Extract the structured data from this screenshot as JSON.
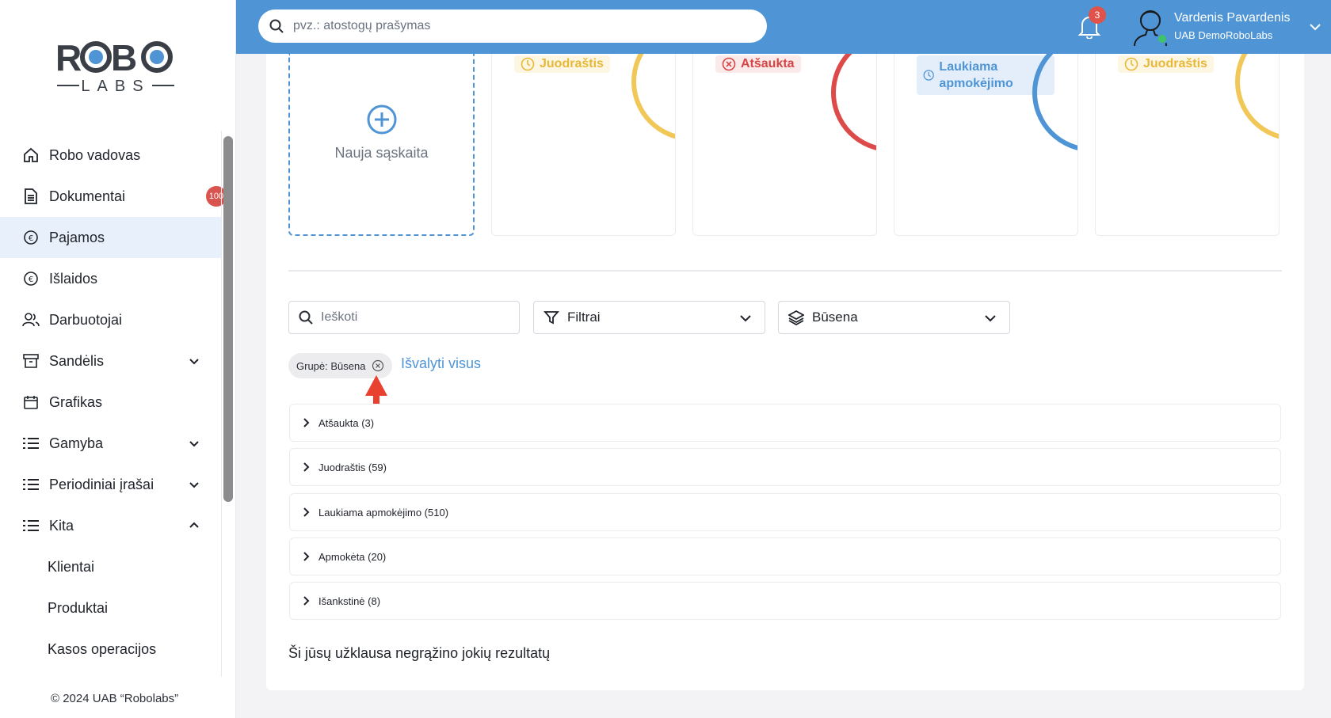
{
  "brand": {
    "logo_top": "ROBO",
    "logo_bottom": "LABS"
  },
  "sidebar": {
    "items": [
      {
        "label": "Robo vadovas",
        "icon": "home-icon"
      },
      {
        "label": "Dokumentai",
        "icon": "document-icon",
        "badge": "100"
      },
      {
        "label": "Pajamos",
        "icon": "income-icon",
        "active": true
      },
      {
        "label": "Išlaidos",
        "icon": "expense-icon"
      },
      {
        "label": "Darbuotojai",
        "icon": "users-icon"
      },
      {
        "label": "Sandėlis",
        "icon": "archive-icon",
        "expandable": true
      },
      {
        "label": "Grafikas",
        "icon": "calendar-icon"
      },
      {
        "label": "Gamyba",
        "icon": "list-icon",
        "expandable": true
      },
      {
        "label": "Periodiniai įrašai",
        "icon": "list-icon",
        "expandable": true
      },
      {
        "label": "Kita",
        "icon": "list-icon",
        "expandable": true,
        "expanded": true
      },
      {
        "label": "Klientai",
        "sub": true
      },
      {
        "label": "Produktai",
        "sub": true
      },
      {
        "label": "Kasos operacijos",
        "sub": true
      }
    ],
    "copyright": "© 2024 UAB “Robolabs”"
  },
  "topbar": {
    "search_placeholder": "pvz.: atostogų prašymas",
    "notifications": "3",
    "user_name": "Vardenis Pavardenis",
    "company": "UAB DemoRoboLabs"
  },
  "cards": {
    "new_label": "Nauja sąskaita",
    "items": [
      {
        "status": "Juodraštis",
        "color": "#e8b838"
      },
      {
        "status": "Atšaukta",
        "color": "#d64545"
      },
      {
        "status": "Laukiama apmokėjimo",
        "color": "#4f95d6"
      },
      {
        "status": "Juodraštis",
        "color": "#e8b838"
      }
    ]
  },
  "filters": {
    "search_placeholder": "Ieškoti",
    "filters_label": "Filtrai",
    "status_label": "Būsena"
  },
  "chip": {
    "label": "Grupė: Būsena",
    "clear_all": "Išvalyti visus"
  },
  "groups": [
    "Atšaukta (3)",
    "Juodraštis (59)",
    "Laukiama apmokėjimo (510)",
    "Apmokėta (20)",
    "Išankstinė (8)"
  ],
  "empty_message": "Ši jūsų užklausa negrąžino jokių rezultatų",
  "colors": {
    "accent": "#4f95d6",
    "yellow": "#e8b838",
    "red": "#d64545"
  }
}
